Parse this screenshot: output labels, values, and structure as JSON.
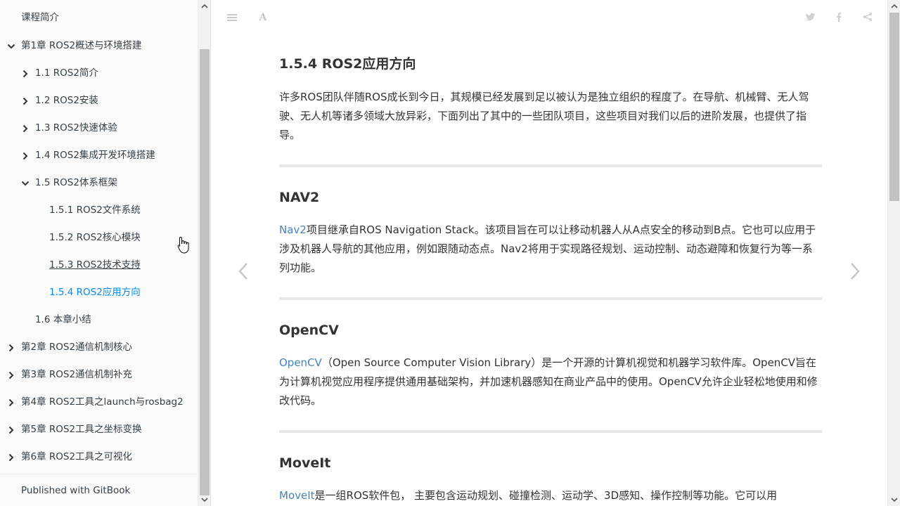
{
  "sidebar": {
    "items": [
      {
        "label": "课程简介",
        "level": 0,
        "chevron": "none"
      },
      {
        "label": "第1章 ROS2概述与环境搭建",
        "level": 0,
        "chevron": "down"
      },
      {
        "label": "1.1 ROS2简介",
        "level": 1,
        "chevron": "right"
      },
      {
        "label": "1.2 ROS2安装",
        "level": 1,
        "chevron": "right"
      },
      {
        "label": "1.3 ROS2快速体验",
        "level": 1,
        "chevron": "right"
      },
      {
        "label": "1.4 ROS2集成开发环境搭建",
        "level": 1,
        "chevron": "right"
      },
      {
        "label": "1.5 ROS2体系框架",
        "level": 1,
        "chevron": "down"
      },
      {
        "label": "1.5.1 ROS2文件系统",
        "level": 2,
        "chevron": "none"
      },
      {
        "label": "1.5.2 ROS2核心模块",
        "level": 2,
        "chevron": "none"
      },
      {
        "label": "1.5.3 ROS2技术支持",
        "level": 2,
        "chevron": "none",
        "state": "visited"
      },
      {
        "label": "1.5.4 ROS2应用方向",
        "level": 2,
        "chevron": "none",
        "state": "active"
      },
      {
        "label": "1.6 本章小结",
        "level": 1,
        "chevron": "none"
      },
      {
        "label": "第2章 ROS2通信机制核心",
        "level": 0,
        "chevron": "right"
      },
      {
        "label": "第3章 ROS2通信机制补充",
        "level": 0,
        "chevron": "right"
      },
      {
        "label": "第4章 ROS2工具之launch与rosbag2",
        "level": 0,
        "chevron": "right"
      },
      {
        "label": "第5章 ROS2工具之坐标变换",
        "level": 0,
        "chevron": "right"
      },
      {
        "label": "第6章 ROS2工具之可视化",
        "level": 0,
        "chevron": "right"
      }
    ],
    "footer": "Published with GitBook"
  },
  "toolbar": {
    "menu_icon": "menu-icon",
    "font_icon": "font-settings-icon",
    "font_glyph": "A",
    "share_icons": [
      "twitter-icon",
      "facebook-icon",
      "share-icon"
    ]
  },
  "watermark": "",
  "article": {
    "title": "1.5.4 ROS2应用方向",
    "intro": "许多ROS团队伴随ROS成长到今日，其规模已经发展到足以被认为是独立组织的程度了。在导航、机械臂、无人驾驶、无人机等诸多领域大放异彩，下面列出了其中的一些团队项目，这些项目对我们以后的进阶发展，也提供了指导。",
    "sections": [
      {
        "heading": "NAV2",
        "link": "Nav2",
        "text": "项目继承自ROS Navigation Stack。该项目旨在可以让移动机器人从A点安全的移动到B点。它也可以应用于涉及机器人导航的其他应用，例如跟随动态点。Nav2将用于实现路径规划、运动控制、动态避障和恢复行为等一系列功能。"
      },
      {
        "heading": "OpenCV",
        "link": "OpenCV",
        "text": "（Open Source Computer Vision Library）是一个开源的计算机视觉和机器学习软件库。OpenCV旨在为计算机视觉应用程序提供通用基础架构，并加速机器感知在商业产品中的使用。OpenCV允许企业轻松地使用和修改代码。"
      },
      {
        "heading": "MoveIt",
        "link": "MoveIt",
        "text": "是一组ROS软件包， 主要包含运动规划、碰撞检测、运动学、3D感知、操作控制等功能。它可以用"
      }
    ]
  },
  "colors": {
    "accent": "#008cff",
    "link": "#4183c4"
  }
}
